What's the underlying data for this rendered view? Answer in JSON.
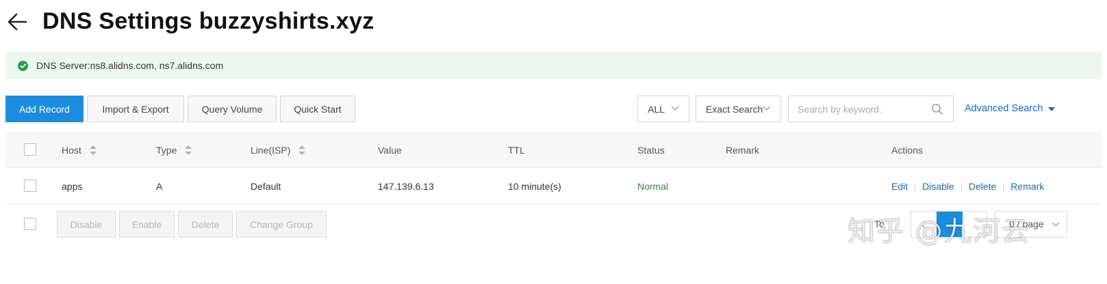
{
  "header": {
    "title": "DNS Settings buzzyshirts.xyz"
  },
  "notice": {
    "text": "DNS Server:ns8.alidns.com, ns7.alidns.com"
  },
  "toolbar": {
    "add_record": "Add Record",
    "import_export": "Import & Export",
    "query_volume": "Query Volume",
    "quick_start": "Quick Start",
    "type_filter": "ALL",
    "search_mode": "Exact Search",
    "search_placeholder": "Search by keyword.",
    "advanced_search": "Advanced Search"
  },
  "table": {
    "columns": [
      "Host",
      "Type",
      "Line(ISP)",
      "Value",
      "TTL",
      "Status",
      "Remark",
      "Actions"
    ],
    "rows": [
      {
        "host": "apps",
        "type": "A",
        "line": "Default",
        "value": "147.139.6.13",
        "ttl": "10 minute(s)",
        "status": "Normal",
        "remark": "",
        "actions": [
          "Edit",
          "Disable",
          "Delete",
          "Remark"
        ]
      }
    ]
  },
  "bulk": {
    "disable": "Disable",
    "enable": "Enable",
    "delete": "Delete",
    "change_group": "Change Group"
  },
  "pagination": {
    "total_fragment": "To",
    "page_size_fragment": "0 / page"
  },
  "watermark": {
    "text": "知乎 @九河云"
  },
  "colors": {
    "primary": "#1a8de0",
    "link": "#1a6ab8",
    "status_normal": "#2e8b47",
    "notice_bg": "#ecf8ef"
  }
}
